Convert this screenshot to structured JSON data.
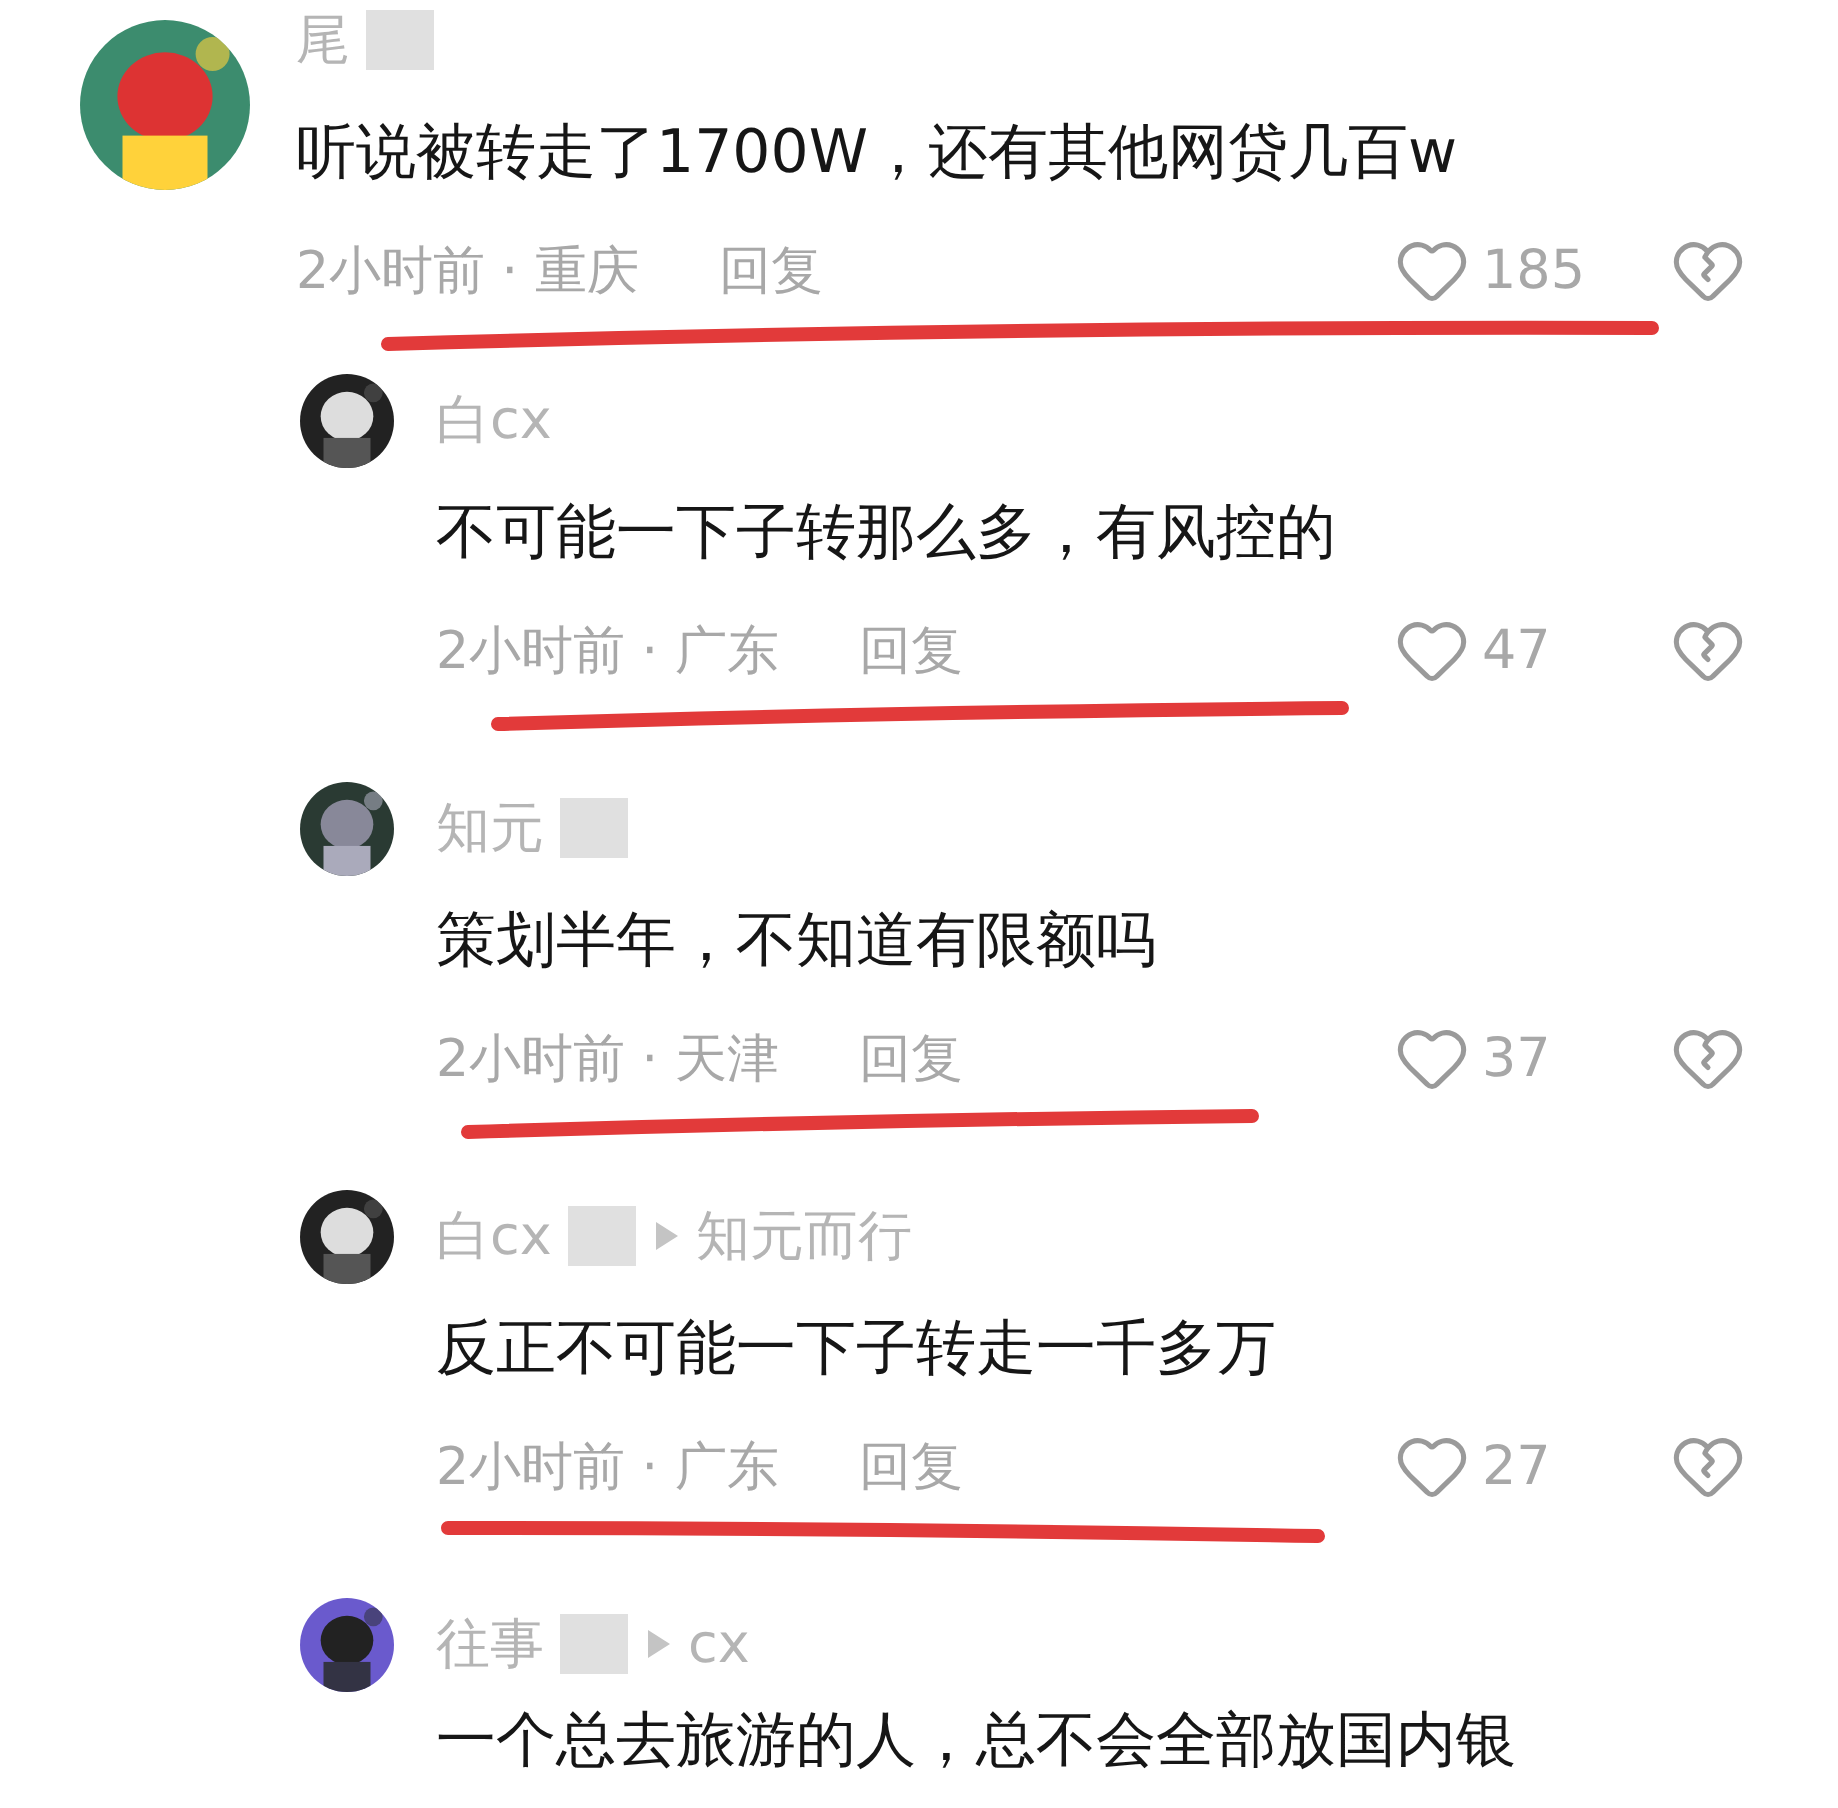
{
  "comments": [
    {
      "kind": "top",
      "name": "尾",
      "redacted": true,
      "text": "听说被转走了1700W，还有其他网贷几百w",
      "time": "2小时前 · 重庆",
      "reply_label": "回复",
      "likes": "185",
      "struck": true
    },
    {
      "kind": "reply",
      "name": "白cx",
      "redacted": false,
      "text": "不可能一下子转那么多，有风控的",
      "time": "2小时前 · 广东",
      "reply_label": "回复",
      "likes": "47",
      "struck": true
    },
    {
      "kind": "reply",
      "name": "知元",
      "redacted": true,
      "text": "策划半年，不知道有限额吗",
      "time": "2小时前 · 天津",
      "reply_label": "回复",
      "likes": "37",
      "struck": true
    },
    {
      "kind": "reply",
      "name": "白cx",
      "redacted": true,
      "reply_to": "知元而行",
      "text": "反正不可能一下子转走一千多万",
      "time": "2小时前 · 广东",
      "reply_label": "回复",
      "likes": "27",
      "struck": true
    },
    {
      "kind": "reply",
      "name": "往事",
      "redacted": true,
      "reply_to": "cx",
      "text": "一个总去旅游的人，总不会全部放国内银",
      "struck": false
    }
  ]
}
